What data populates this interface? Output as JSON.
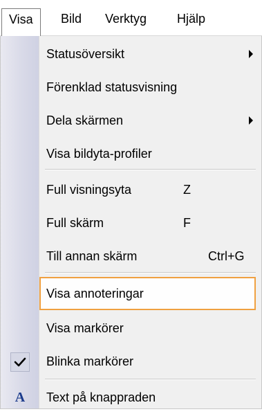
{
  "menubar": {
    "items": [
      {
        "label": "Visa",
        "active": true
      },
      {
        "label": "Bild",
        "active": false
      },
      {
        "label": "Verktyg",
        "active": false
      },
      {
        "label": "Hjälp",
        "active": false
      }
    ]
  },
  "menu": {
    "items": [
      {
        "label": "Statusöversikt",
        "shortcut": "",
        "submenu": true
      },
      {
        "label": "Förenklad statusvisning",
        "shortcut": "",
        "submenu": false
      },
      {
        "label": "Dela skärmen",
        "shortcut": "",
        "submenu": true
      },
      {
        "label": "Visa bildyta-profiler",
        "shortcut": "",
        "submenu": false
      },
      {
        "label": "Full visningsyta",
        "shortcut": "Z",
        "submenu": false
      },
      {
        "label": "Full skärm",
        "shortcut": "F",
        "submenu": false
      },
      {
        "label": "Till annan skärm",
        "shortcut": "Ctrl+G",
        "submenu": false
      },
      {
        "label": "Visa annoteringar",
        "shortcut": "",
        "submenu": false,
        "highlighted": true
      },
      {
        "label": "Visa markörer",
        "shortcut": "",
        "submenu": false
      },
      {
        "label": "Blinka markörer",
        "shortcut": "",
        "submenu": false,
        "checked": true
      },
      {
        "label": "Text på knappraden",
        "shortcut": "",
        "submenu": false,
        "icon": "text-a-icon"
      }
    ]
  },
  "colors": {
    "highlight_border": "#f0a040",
    "menu_background": "#f0f0f0",
    "gutter": "#d9dae8",
    "icon_blue": "#1c3c8c"
  }
}
